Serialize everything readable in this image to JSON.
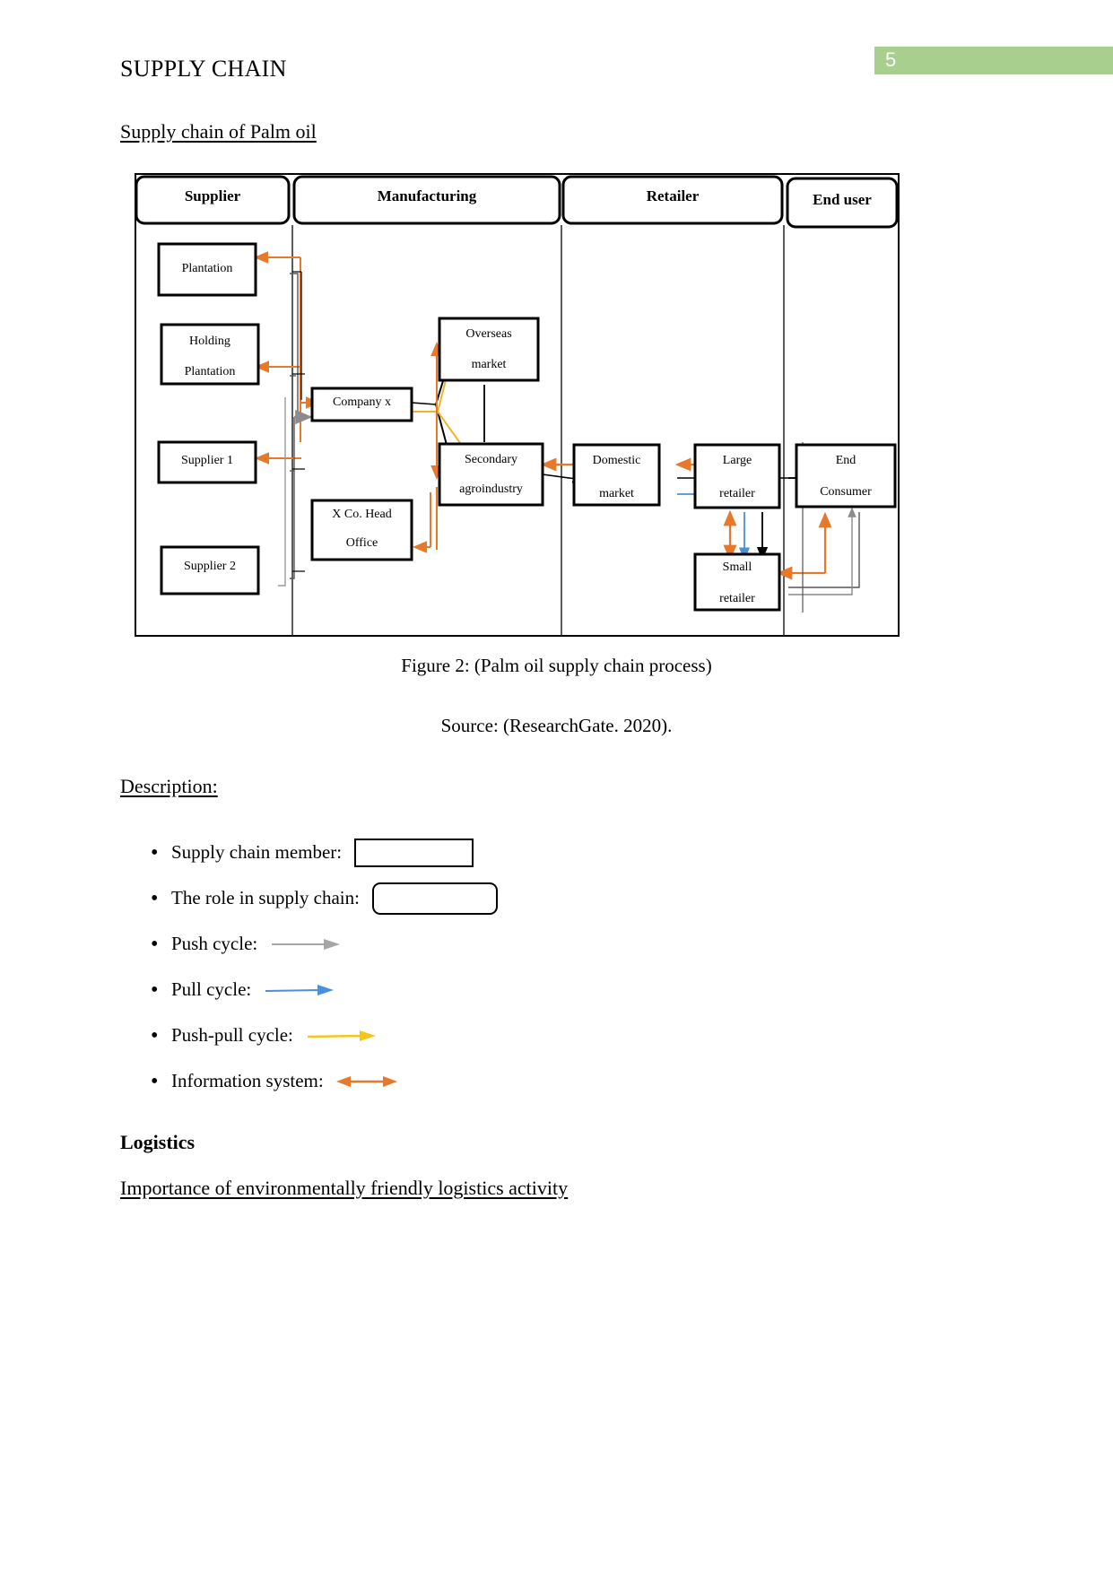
{
  "page": {
    "number": "5",
    "badge_color": "#a9cf8f"
  },
  "header": {
    "title": "SUPPLY CHAIN"
  },
  "sections": {
    "supply_chain_heading": "Supply chain of Palm oil ",
    "description_heading": "Description:",
    "logistics_heading": "Logistics",
    "importance_heading": "Importance of environmentally friendly logistics activity"
  },
  "figure": {
    "caption": "Figure 2: (Palm oil supply chain process)",
    "source": "Source: (ResearchGate. 2020).",
    "lanes": [
      {
        "label": "Supplier"
      },
      {
        "label": "Manufacturing"
      },
      {
        "label": "Retailer"
      },
      {
        "label": "End user"
      }
    ],
    "nodes": [
      {
        "id": "plantation",
        "lines": [
          "Plantation"
        ]
      },
      {
        "id": "holding-plantation",
        "lines": [
          "Holding",
          "Plantation"
        ]
      },
      {
        "id": "supplier-1",
        "lines": [
          "Supplier 1"
        ]
      },
      {
        "id": "supplier-2",
        "lines": [
          "Supplier 2"
        ]
      },
      {
        "id": "company-x",
        "lines": [
          "Company x"
        ]
      },
      {
        "id": "x-co-head-office",
        "lines": [
          "X Co. Head",
          "Office"
        ]
      },
      {
        "id": "overseas-market",
        "lines": [
          "Overseas",
          "market"
        ]
      },
      {
        "id": "secondary-agroindustry",
        "lines": [
          "Secondary",
          "agroindustry"
        ]
      },
      {
        "id": "domestic-market",
        "lines": [
          "Domestic",
          "market"
        ]
      },
      {
        "id": "large-retailer",
        "lines": [
          "Large",
          "retailer"
        ]
      },
      {
        "id": "small-retailer",
        "lines": [
          "Small",
          "retailer"
        ]
      },
      {
        "id": "end-consumer",
        "lines": [
          "End",
          "Consumer"
        ]
      }
    ]
  },
  "description_items": [
    {
      "label": "Supply chain member:",
      "field": "box",
      "value": ""
    },
    {
      "label": "The role in supply chain:",
      "field": "box-rounded",
      "value": ""
    },
    {
      "label": "Push cycle:",
      "field": "arrow",
      "arrow": "single",
      "color": "#a6a6a6"
    },
    {
      "label": "Pull cycle:",
      "field": "arrow",
      "arrow": "single",
      "color": "#4a90d9"
    },
    {
      "label": "Push-pull cycle:",
      "field": "arrow",
      "arrow": "single",
      "color": "#f5c518"
    },
    {
      "label": "Information system:",
      "field": "arrow",
      "arrow": "double",
      "color": "#e8792a"
    }
  ],
  "colors": {
    "information_system": "#e8792a",
    "push_cycle": "#a6a6a6",
    "pull_cycle": "#4a90d9",
    "push_pull_cycle": "#f5c518",
    "material_flow": "#000000"
  }
}
